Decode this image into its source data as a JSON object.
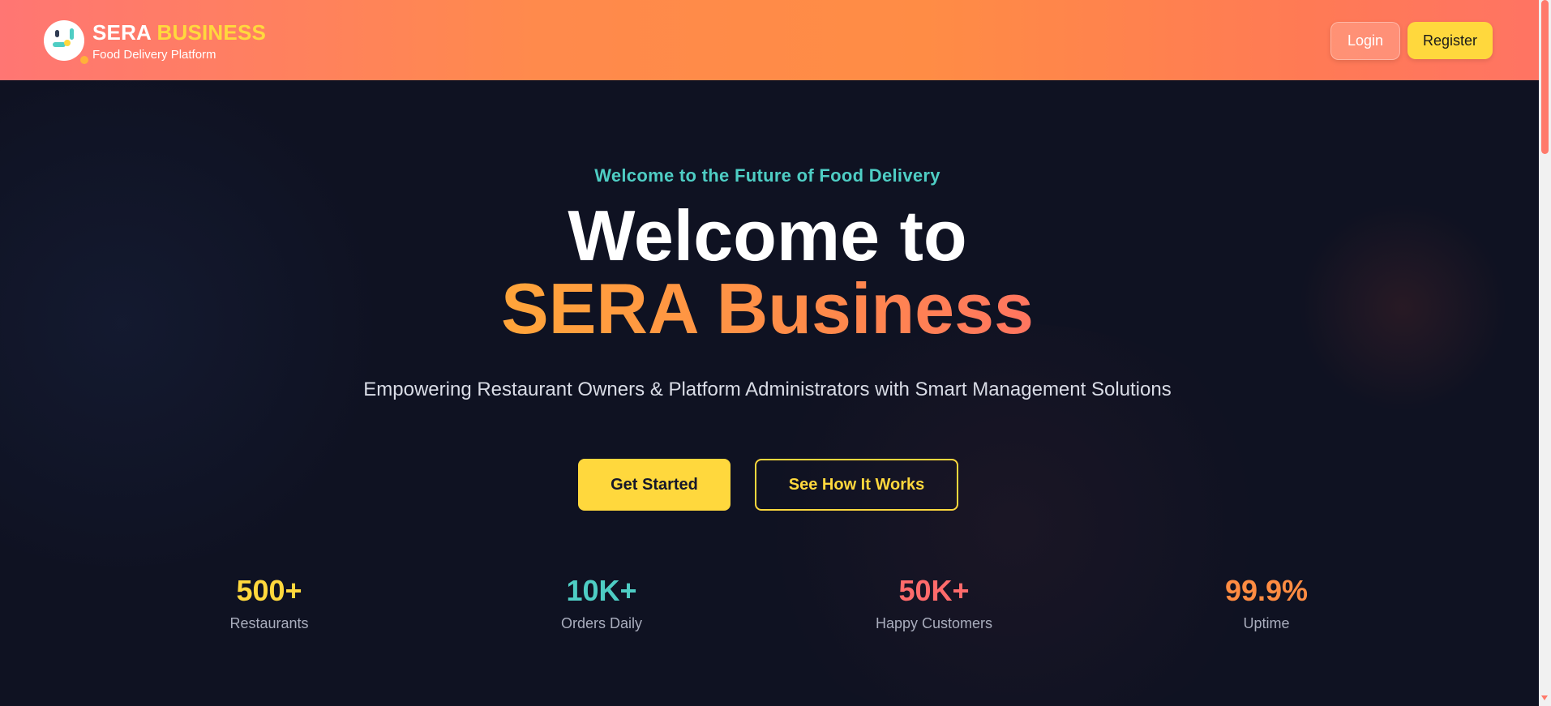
{
  "header": {
    "brand_primary": "SERA",
    "brand_accent": "BUSINESS",
    "tagline": "Food Delivery Platform",
    "login_label": "Login",
    "register_label": "Register"
  },
  "hero": {
    "eyebrow": "Welcome to the Future of Food Delivery",
    "title_line1": "Welcome to",
    "title_line2": "SERA Business",
    "subtitle": "Empowering Restaurant Owners & Platform Administrators with Smart Management Solutions",
    "primary_cta": "Get Started",
    "secondary_cta": "See How It Works"
  },
  "stats": [
    {
      "value": "500+",
      "label": "Restaurants",
      "color": "#ffd83d"
    },
    {
      "value": "10K+",
      "label": "Orders Daily",
      "color": "#4ecdc4"
    },
    {
      "value": "50K+",
      "label": "Happy Customers",
      "color": "#ff6b6b"
    },
    {
      "value": "99.9%",
      "label": "Uptime",
      "color": "#ff8c42"
    }
  ],
  "colors": {
    "brand_yellow": "#ffd83d",
    "teal": "#4ecdc4",
    "coral": "#ff6b6b",
    "orange": "#ff8c42",
    "hero_bg": "#0f1222"
  },
  "icons": {
    "logo": "sera-logo-icon"
  }
}
